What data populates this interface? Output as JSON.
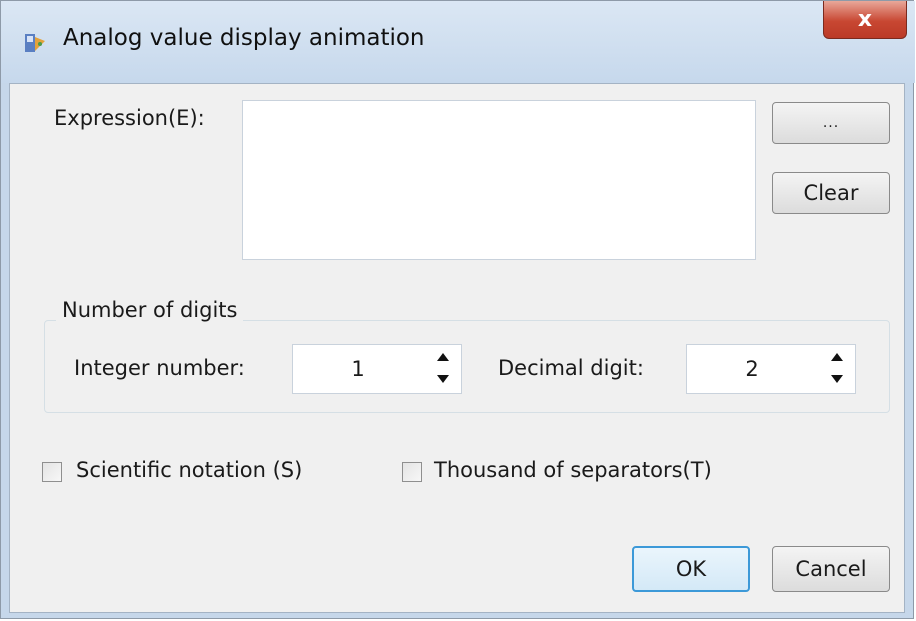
{
  "window": {
    "title": "Analog value display animation",
    "close_label": "x"
  },
  "expression": {
    "label": "Expression(E):",
    "value": "",
    "browse_label": "...",
    "clear_label": "Clear"
  },
  "digits": {
    "group_title": "Number of digits",
    "integer_label": "Integer number:",
    "integer_value": "1",
    "decimal_label": "Decimal digit:",
    "decimal_value": "2"
  },
  "options": {
    "scientific_label": "Scientific notation (S)",
    "scientific_checked": false,
    "thousand_label": "Thousand of separators(T)",
    "thousand_checked": false
  },
  "footer": {
    "ok_label": "OK",
    "cancel_label": "Cancel"
  },
  "colors": {
    "titlebar": "#c6d8ec",
    "close_button": "#c84732",
    "ok_border": "#3c99d8"
  }
}
